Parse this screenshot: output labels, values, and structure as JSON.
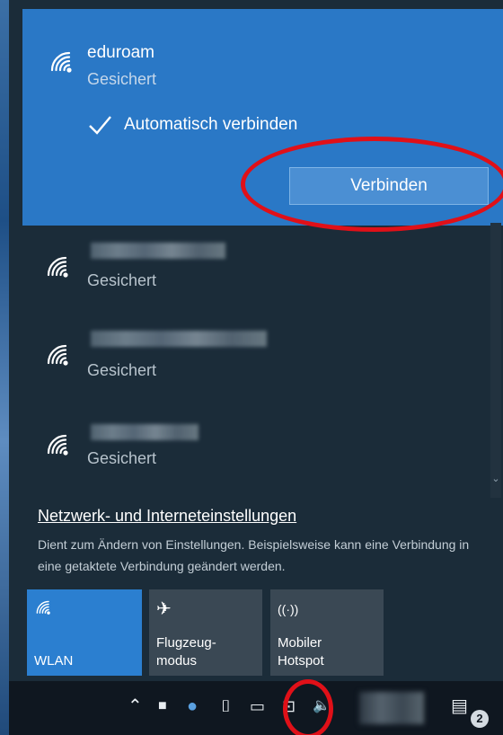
{
  "selected_network": {
    "name": "eduroam",
    "status": "Gesichert",
    "auto_connect_label": "Automatisch verbinden",
    "auto_connect_checked": true,
    "connect_button": "Verbinden"
  },
  "networks": [
    {
      "status": "Gesichert"
    },
    {
      "status": "Gesichert"
    },
    {
      "status": "Gesichert"
    }
  ],
  "settings": {
    "link": "Netzwerk- und Interneteinstellungen",
    "description": "Dient zum Ändern von Einstellungen. Beispielsweise kann eine Verbindung in eine getaktete Verbindung geändert werden."
  },
  "quick_actions": [
    {
      "label": "WLAN",
      "icon": "wifi-icon",
      "active": true
    },
    {
      "label": "Flugzeug-\nmodus",
      "icon": "airplane-icon",
      "active": false
    },
    {
      "label": "Mobiler\nHotspot",
      "icon": "hotspot-icon",
      "active": false
    }
  ],
  "taskbar": {
    "notification_count": "2",
    "icons": [
      "chevron-up-icon",
      "tablet-icon",
      "globe-icon",
      "usb-icon",
      "power-icon",
      "network-icon",
      "volume-icon",
      "notification-center-icon"
    ]
  },
  "colors": {
    "accent": "#2a78c6",
    "flyout_bg": "#1b2c39",
    "annotation_red": "#e01018"
  }
}
